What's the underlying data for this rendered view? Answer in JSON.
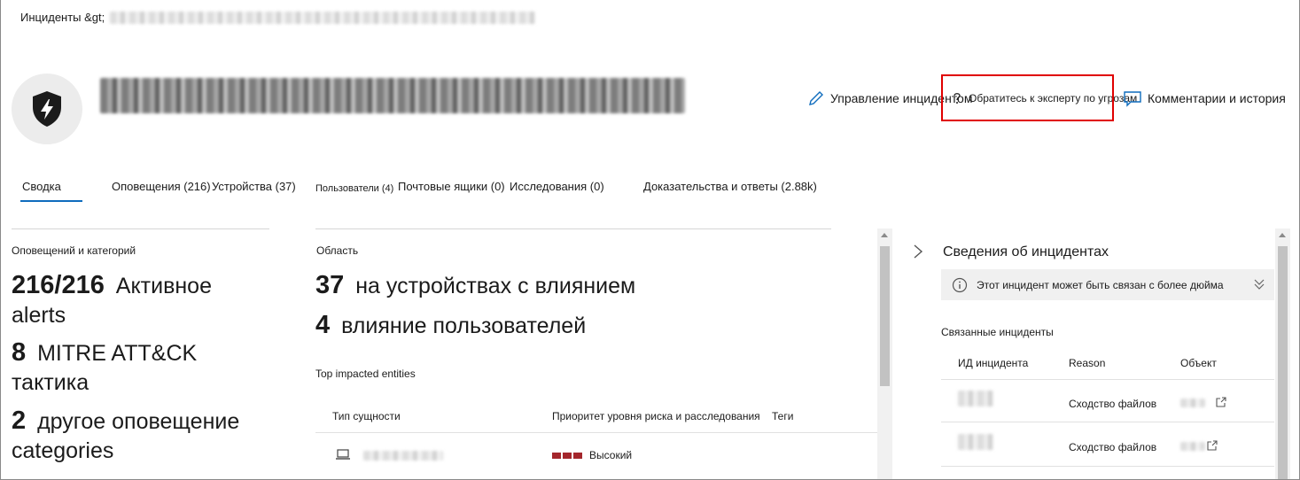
{
  "breadcrumb": {
    "root": "Инциденты &gt;"
  },
  "header": {
    "icon": "shield-lightning-icon"
  },
  "actions": {
    "manage": {
      "label": "Управление инцидентом",
      "icon": "pencil-icon"
    },
    "expert": {
      "label": "Обратитесь к эксперту по угрозам",
      "icon": "question-icon"
    },
    "comments": {
      "label": "Комментарии и история",
      "icon": "comment-icon"
    }
  },
  "tabs": [
    {
      "label": "Сводка",
      "active": true
    },
    {
      "label": "Оповещения (216)"
    },
    {
      "label": "Устройства (37)"
    },
    {
      "label": "Пользователи (4)"
    },
    {
      "label": "Почтовые ящики (0)"
    },
    {
      "label": "Исследования (0)"
    },
    {
      "label": "Доказательства и ответы (2.88k)"
    }
  ],
  "alerts_section": {
    "label": "Оповещений и категорий",
    "active_count": "216/216",
    "active_text": "Активное",
    "active_text2": "alerts",
    "mitre_count": "8",
    "mitre_text": "MITRE ATT&CK",
    "mitre_text2": "тактика",
    "other_count": "2",
    "other_text": "другое оповещение",
    "other_text2": "categories"
  },
  "scope_section": {
    "label": "Область",
    "devices_count": "37",
    "devices_text": "на устройствах с влиянием",
    "users_count": "4",
    "users_text": "влияние пользователей",
    "top_entities_label": "Top impacted entities",
    "columns": [
      "Тип сущности",
      "Приоритет уровня риска и расследования",
      "Теги"
    ],
    "rows": [
      {
        "type_icon": "laptop-icon",
        "risk": "Высокий"
      }
    ]
  },
  "incident_info": {
    "title": "Сведения об инцидентах",
    "banner": "Этот инцидент может быть связан с более дюйма",
    "related_title": "Связанные инциденты",
    "columns": [
      "ИД инцидента",
      "Reason",
      "Объект"
    ],
    "rows": [
      {
        "reason": "Сходство файлов"
      },
      {
        "reason": "Сходство файлов"
      }
    ]
  },
  "colors": {
    "accent": "#0f6cbd",
    "highlight": "#e00000",
    "risk_high": "#a4262c"
  }
}
